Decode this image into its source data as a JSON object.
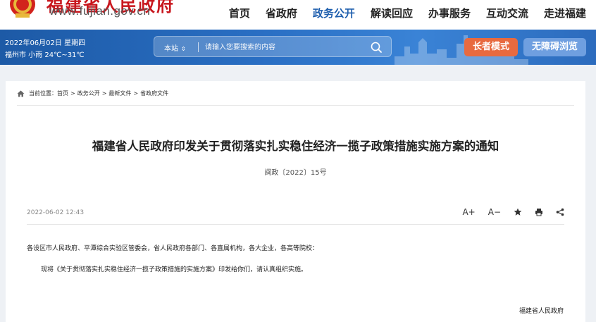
{
  "header": {
    "site_title": "福建省人民政府",
    "site_url": "www.fujian.gov.cn",
    "nav": [
      {
        "label": "首页",
        "active": false
      },
      {
        "label": "省政府",
        "active": false
      },
      {
        "label": "政务公开",
        "active": true
      },
      {
        "label": "解读回应",
        "active": false
      },
      {
        "label": "办事服务",
        "active": false
      },
      {
        "label": "互动交流",
        "active": false
      },
      {
        "label": "走进福建",
        "active": false
      }
    ]
  },
  "infobar": {
    "date": "2022年06月02日 星期四",
    "weather": "福州市 小雨 24℃~31℃",
    "search": {
      "scope_label": "本站",
      "placeholder": "请输入您要搜索的内容"
    },
    "elder_mode_label": "长者模式",
    "accessible_label": "无障碍浏览"
  },
  "breadcrumb": {
    "prefix": "当前位置：",
    "items": [
      "首页",
      "政务公开",
      "最新文件",
      "省政府文件"
    ],
    "separator": ">"
  },
  "article": {
    "title": "福建省人民政府印发关于贯彻落实扎实稳住经济一揽子政策措施实施方案的通知",
    "doc_number": "闽政〔2022〕15号",
    "date": "2022-06-02 12:43",
    "tools": {
      "font_increase": "A+",
      "font_decrease": "A−"
    },
    "paragraphs": [
      "各设区市人民政府、平潭综合实验区管委会，省人民政府各部门、各直属机构，各大企业，各高等院校：",
      "现将《关于贯彻落实扎实稳住经济一揽子政策措施的实施方案》印发给你们，请认真组织实施。"
    ],
    "signature": "福建省人民政府"
  },
  "colors": {
    "brand_red": "#c8161d",
    "nav_active": "#1f5fae",
    "bar_blue": "#2a6fc4",
    "elder_button": "#e86a3f",
    "accessible_button": "#6f9fe0"
  },
  "icons": [
    "national-emblem-icon",
    "sort-arrows-icon",
    "search-icon",
    "home-icon",
    "star-icon",
    "print-icon",
    "share-icon"
  ]
}
